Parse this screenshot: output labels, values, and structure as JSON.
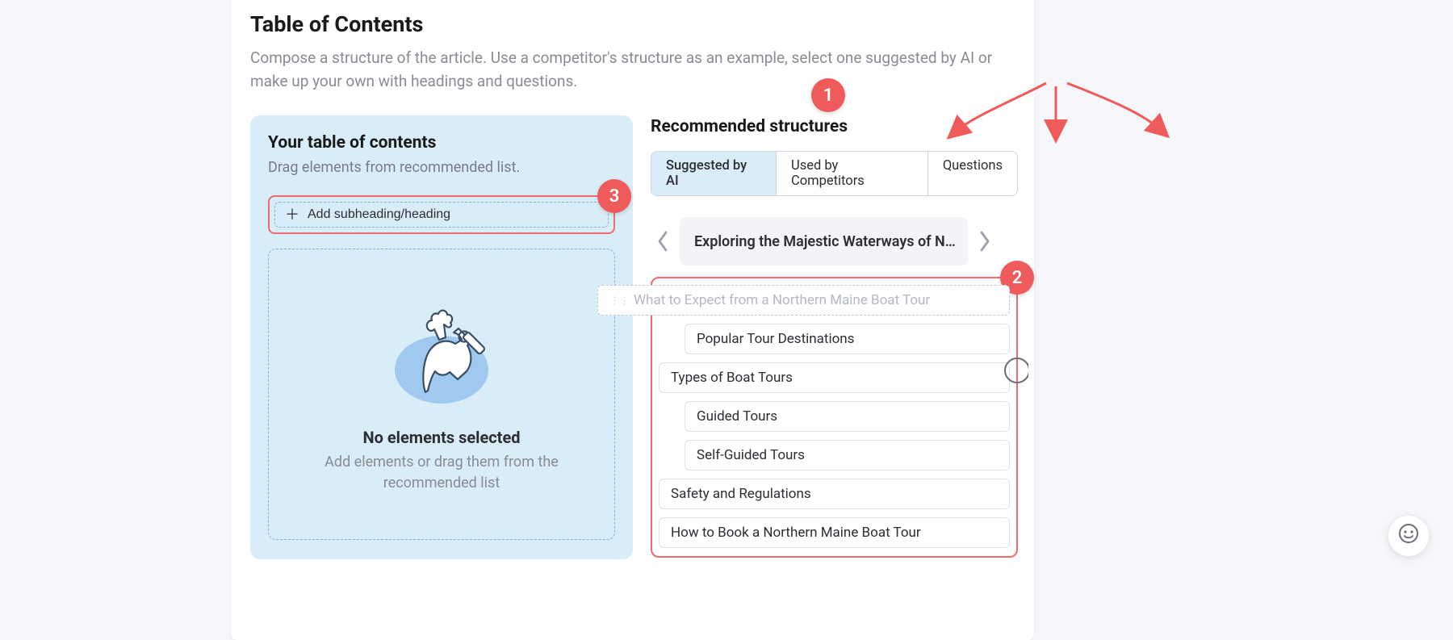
{
  "page": {
    "title": "Table of Contents",
    "description": "Compose a structure of the article. Use a competitor's structure as an example, select one suggested by AI or make up your own with headings and questions."
  },
  "left": {
    "title": "Your table of contents",
    "subtitle": "Drag elements from recommended list.",
    "add_label": "Add subheading/heading",
    "empty_title": "No elements selected",
    "empty_desc": "Add elements or drag them from the recommended list"
  },
  "right": {
    "title": "Recommended structures",
    "tabs": {
      "ai": "Suggested by AI",
      "competitors": "Used by Competitors",
      "questions": "Questions"
    },
    "carousel_title": "Exploring the Majestic Waterways of N…",
    "items": [
      {
        "label": "What to Expect from a Northern Maine Boat Tour",
        "level": 1,
        "dragging": true
      },
      {
        "label": "Popular Tour Destinations",
        "level": 2
      },
      {
        "label": "Types of Boat Tours",
        "level": 1
      },
      {
        "label": "Guided Tours",
        "level": 2
      },
      {
        "label": "Self-Guided Tours",
        "level": 2
      },
      {
        "label": "Safety and Regulations",
        "level": 1
      },
      {
        "label": "How to Book a Northern Maine Boat Tour",
        "level": 1
      }
    ]
  },
  "annotations": {
    "b1": "1",
    "b2": "2",
    "b3": "3"
  },
  "colors": {
    "accent_blue": "#d9edf9",
    "annotation_red": "#ef5a5a"
  }
}
